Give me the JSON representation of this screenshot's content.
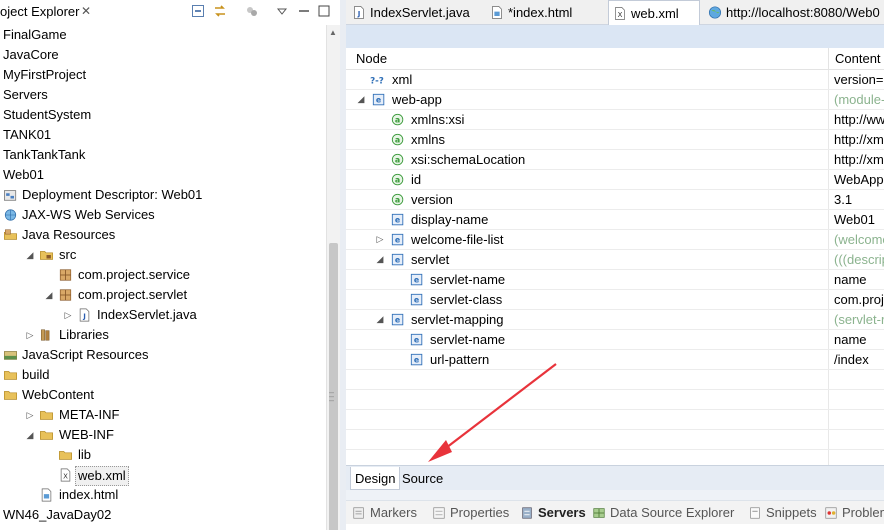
{
  "explorer": {
    "title": "oject Explorer",
    "close_glyph": "✕",
    "toolbar_icons": [
      "collapse-all-icon",
      "link-with-editor-icon",
      "filters-icon",
      "view-menu-icon",
      "minimize-icon"
    ],
    "items": [
      {
        "label": "FinalGame",
        "level": 0,
        "icon": "none",
        "twisty": ""
      },
      {
        "label": "JavaCore",
        "level": 0,
        "icon": "none",
        "twisty": ""
      },
      {
        "label": "MyFirstProject",
        "level": 0,
        "icon": "none",
        "twisty": ""
      },
      {
        "label": "Servers",
        "level": 0,
        "icon": "none",
        "twisty": ""
      },
      {
        "label": "StudentSystem",
        "level": 0,
        "icon": "none",
        "twisty": ""
      },
      {
        "label": "TANK01",
        "level": 0,
        "icon": "none",
        "twisty": ""
      },
      {
        "label": "TankTankTank",
        "level": 0,
        "icon": "none",
        "twisty": ""
      },
      {
        "label": "Web01",
        "level": 0,
        "icon": "none",
        "twisty": ""
      },
      {
        "label": "Deployment Descriptor: Web01",
        "level": 0,
        "icon": "deployment-descriptor-icon",
        "twisty": ""
      },
      {
        "label": "JAX-WS Web Services",
        "level": 0,
        "icon": "web-services-icon",
        "twisty": ""
      },
      {
        "label": "Java Resources",
        "level": 0,
        "icon": "java-resources-icon",
        "twisty": ""
      },
      {
        "label": "src",
        "level": 1,
        "icon": "source-folder-icon",
        "twisty": "open"
      },
      {
        "label": "com.project.service",
        "level": 2,
        "icon": "package-icon",
        "twisty": ""
      },
      {
        "label": "com.project.servlet",
        "level": 2,
        "icon": "package-icon",
        "twisty": "open"
      },
      {
        "label": "IndexServlet.java",
        "level": 3,
        "icon": "java-file-icon",
        "twisty": "closed"
      },
      {
        "label": "Libraries",
        "level": 1,
        "icon": "libraries-icon",
        "twisty": "closed"
      },
      {
        "label": "JavaScript Resources",
        "level": 0,
        "icon": "javascript-resources-icon",
        "twisty": ""
      },
      {
        "label": "build",
        "level": 0,
        "icon": "folder-icon",
        "twisty": ""
      },
      {
        "label": "WebContent",
        "level": 0,
        "icon": "folder-icon",
        "twisty": ""
      },
      {
        "label": "META-INF",
        "level": 1,
        "icon": "folder-icon",
        "twisty": "closed"
      },
      {
        "label": "WEB-INF",
        "level": 1,
        "icon": "folder-icon",
        "twisty": "open"
      },
      {
        "label": "lib",
        "level": 2,
        "icon": "folder-icon",
        "twisty": ""
      },
      {
        "label": "web.xml",
        "level": 2,
        "icon": "xml-file-icon",
        "twisty": "",
        "selected": true
      },
      {
        "label": "index.html",
        "level": 1,
        "icon": "html-file-icon",
        "twisty": ""
      },
      {
        "label": "WN46_JavaDay02",
        "level": 0,
        "icon": "none",
        "twisty": ""
      }
    ]
  },
  "editor": {
    "tabs": [
      {
        "label": "IndexServlet.java",
        "icon": "java-file-icon",
        "active": false
      },
      {
        "label": "*index.html",
        "icon": "html-file-icon",
        "active": false
      },
      {
        "label": "web.xml",
        "icon": "xml-file-icon",
        "active": true
      },
      {
        "label": "http://localhost:8080/Web0",
        "icon": "globe-icon",
        "active": false
      }
    ],
    "columns": {
      "node": "Node",
      "content": "Content"
    },
    "rows": [
      {
        "node": "xml",
        "content": "version=",
        "level": 0,
        "icon": "processing-instruction-icon",
        "twisty": "",
        "grey": false
      },
      {
        "node": "web-app",
        "content": "(module-",
        "level": 0,
        "icon": "element-icon",
        "twisty": "open",
        "grey": true
      },
      {
        "node": "xmlns:xsi",
        "content": "http://ww",
        "level": 1,
        "icon": "attribute-icon",
        "twisty": "",
        "grey": false
      },
      {
        "node": "xmlns",
        "content": "http://xm",
        "level": 1,
        "icon": "attribute-icon",
        "twisty": "",
        "grey": false
      },
      {
        "node": "xsi:schemaLocation",
        "content": "http://xm",
        "level": 1,
        "icon": "attribute-icon",
        "twisty": "",
        "grey": false
      },
      {
        "node": "id",
        "content": "WebApp",
        "level": 1,
        "icon": "attribute-icon",
        "twisty": "",
        "grey": false
      },
      {
        "node": "version",
        "content": "3.1",
        "level": 1,
        "icon": "attribute-icon",
        "twisty": "",
        "grey": false
      },
      {
        "node": "display-name",
        "content": "Web01",
        "level": 1,
        "icon": "element-icon",
        "twisty": "",
        "grey": false
      },
      {
        "node": "welcome-file-list",
        "content": "(welcome",
        "level": 1,
        "icon": "element-icon",
        "twisty": "closed",
        "grey": true
      },
      {
        "node": "servlet",
        "content": "(((descrip",
        "level": 1,
        "icon": "element-icon",
        "twisty": "open",
        "grey": true
      },
      {
        "node": "servlet-name",
        "content": "name",
        "level": 2,
        "icon": "element-icon",
        "twisty": "",
        "grey": false
      },
      {
        "node": "servlet-class",
        "content": "com.proj",
        "level": 2,
        "icon": "element-icon",
        "twisty": "",
        "grey": false
      },
      {
        "node": "servlet-mapping",
        "content": "(servlet-r",
        "level": 1,
        "icon": "element-icon",
        "twisty": "open",
        "grey": true
      },
      {
        "node": "servlet-name",
        "content": "name",
        "level": 2,
        "icon": "element-icon",
        "twisty": "",
        "grey": false
      },
      {
        "node": "url-pattern",
        "content": "/index",
        "level": 2,
        "icon": "element-icon",
        "twisty": "",
        "grey": false
      }
    ],
    "bottom_tabs": [
      {
        "label": "Design",
        "active": true
      },
      {
        "label": "Source",
        "active": false
      }
    ]
  },
  "views": [
    {
      "label": "Markers",
      "icon": "markers-icon",
      "active": false
    },
    {
      "label": "Properties",
      "icon": "properties-icon",
      "active": false
    },
    {
      "label": "Servers",
      "icon": "servers-icon",
      "active": true
    },
    {
      "label": "Data Source Explorer",
      "icon": "data-source-icon",
      "active": false
    },
    {
      "label": "Snippets",
      "icon": "snippets-icon",
      "active": false
    },
    {
      "label": "Problem",
      "icon": "problems-icon",
      "active": false
    }
  ],
  "colors": {
    "arrow": "#e8333b",
    "element_icon": "#2f6fb7",
    "attribute_icon": "#3a9a3a",
    "folder": "#e8c15a",
    "grey_content": "#8bb38e"
  }
}
